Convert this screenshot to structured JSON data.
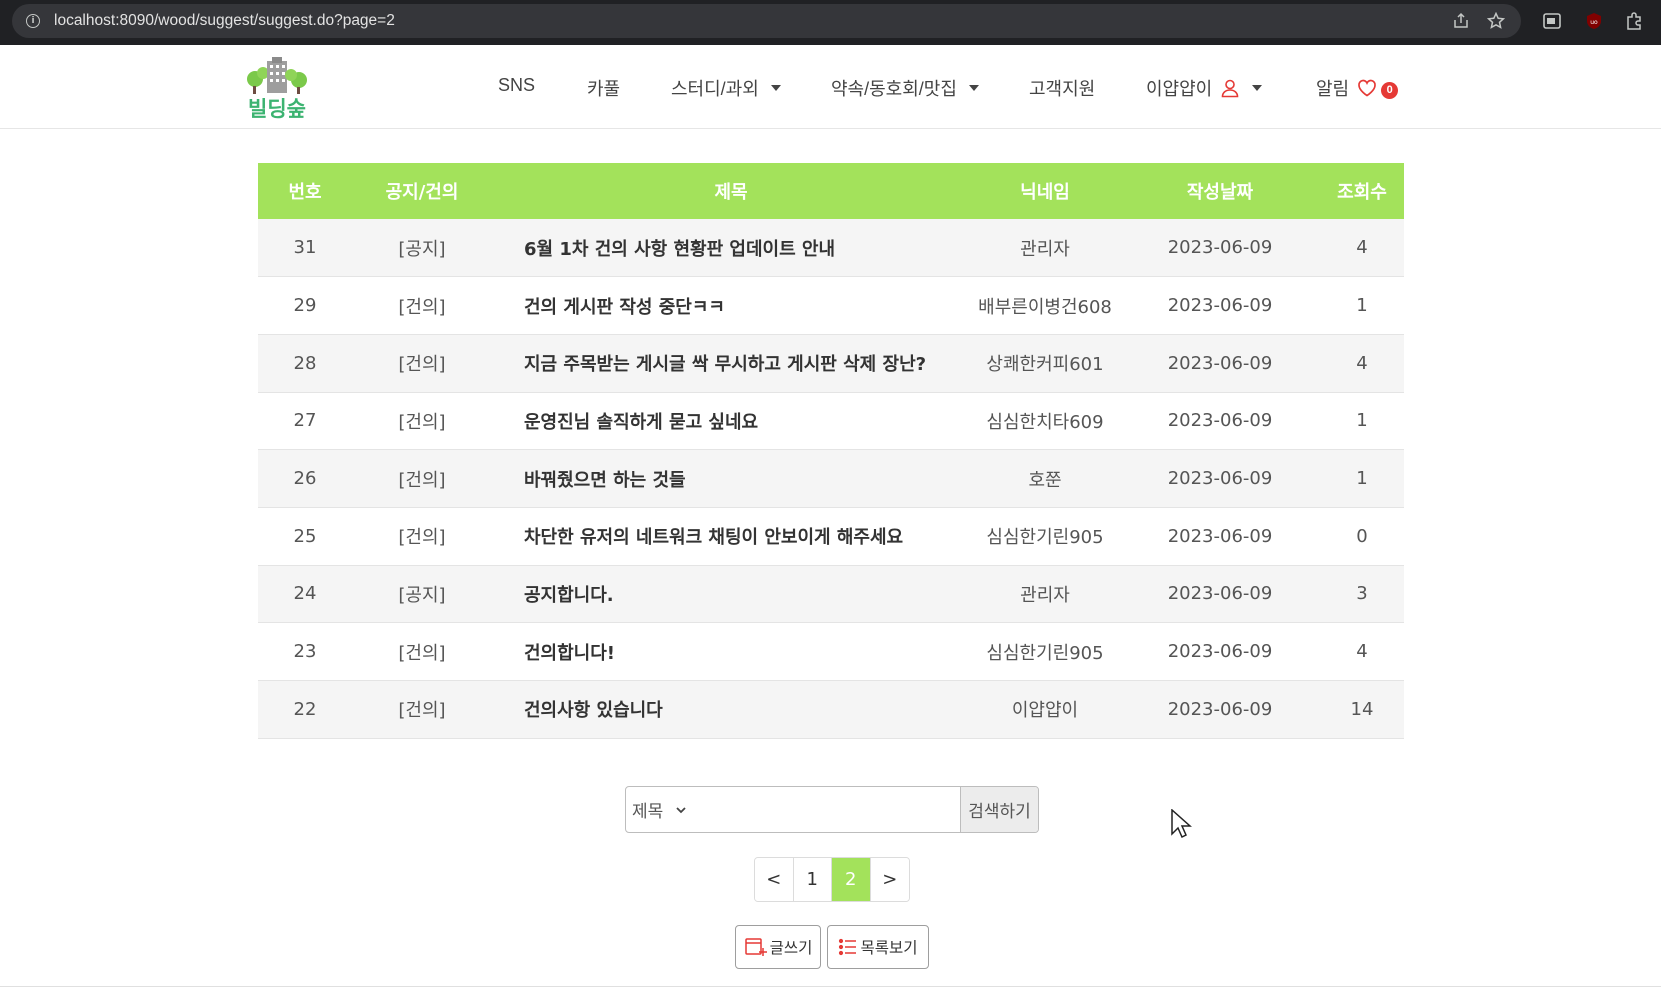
{
  "browser": {
    "url_host": "localhost",
    "url_rest": ":8090/wood/suggest/suggest.do?page=2"
  },
  "nav": {
    "logo_text": "빌딩숲",
    "items": [
      "SNS",
      "카풀",
      "스터디/과외",
      "약속/동호회/맛집",
      "고객지원"
    ],
    "user_name": "이얍얍이",
    "alarm_label": "알림",
    "alarm_count": "0"
  },
  "table": {
    "headers": [
      "번호",
      "공지/건의",
      "제목",
      "닉네임",
      "작성날짜",
      "조회수"
    ],
    "rows": [
      [
        "31",
        "[공지]",
        "6월 1차 건의 사항 현황판 업데이트 안내",
        "관리자",
        "2023-06-09",
        "4"
      ],
      [
        "29",
        "[건의]",
        "건의 게시판 작성 중단ㅋㅋ",
        "배부른이병건608",
        "2023-06-09",
        "1"
      ],
      [
        "28",
        "[건의]",
        "지금 주목받는 게시글 싹 무시하고 게시판 삭제 장난?",
        "상쾌한커피601",
        "2023-06-09",
        "4"
      ],
      [
        "27",
        "[건의]",
        "운영진님 솔직하게 묻고 싶네요",
        "심심한치타609",
        "2023-06-09",
        "1"
      ],
      [
        "26",
        "[건의]",
        "바꿔줬으면 하는 것들",
        "호쭌",
        "2023-06-09",
        "1"
      ],
      [
        "25",
        "[건의]",
        "차단한 유저의 네트워크 채팅이 안보이게 해주세요",
        "심심한기린905",
        "2023-06-09",
        "0"
      ],
      [
        "24",
        "[공지]",
        "공지합니다.",
        "관리자",
        "2023-06-09",
        "3"
      ],
      [
        "23",
        "[건의]",
        "건의합니다!",
        "심심한기린905",
        "2023-06-09",
        "4"
      ],
      [
        "22",
        "[건의]",
        "건의사항 있습니다",
        "이얍얍이",
        "2023-06-09",
        "14"
      ]
    ]
  },
  "search": {
    "select_value": "제목",
    "input_value": "",
    "button_label": "검색하기"
  },
  "pager": {
    "prev": "<",
    "pages": [
      "1",
      "2"
    ],
    "current": "2",
    "next": ">"
  },
  "actions": {
    "write_label": "글쓰기",
    "list_label": "목록보기"
  },
  "colors": {
    "accent_green": "#a3e25b",
    "badge_red": "#e53935",
    "icon_red": "#e53935"
  }
}
